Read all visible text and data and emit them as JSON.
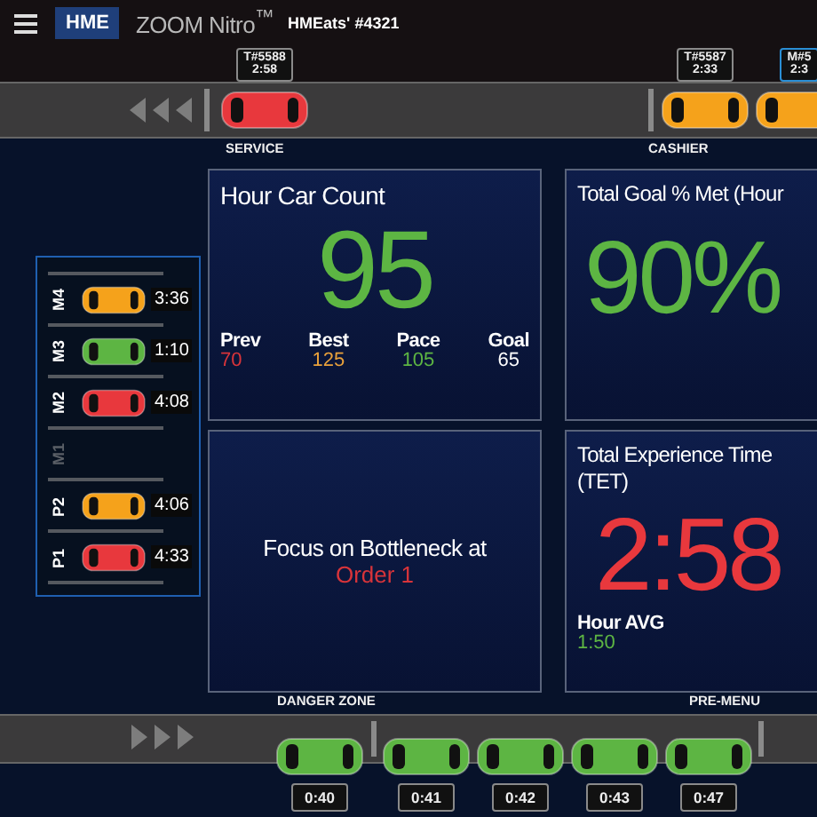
{
  "header": {
    "logo": "HME",
    "product": "ZOOM Nitro$^{™}$",
    "store": "HMEats' #4321"
  },
  "top_lane": {
    "zones": [
      {
        "label": "SERVICE",
        "cars": [
          {
            "color": "#e8383d",
            "ticket": "T#5588",
            "time": "2:58",
            "highlighted": false
          }
        ]
      },
      {
        "label": "CASHIER",
        "cars": [
          {
            "color": "#f5a21b",
            "ticket": "T#5587",
            "time": "2:33",
            "highlighted": false
          },
          {
            "color": "#f5a21b",
            "ticket": "M#5",
            "time": "2:3",
            "highlighted": true
          }
        ]
      }
    ]
  },
  "pull_forward": [
    {
      "label": "M4",
      "active": true,
      "color": "#f5a21b",
      "time": "3:36"
    },
    {
      "label": "M3",
      "active": true,
      "color": "#5db543",
      "time": "1:10"
    },
    {
      "label": "M2",
      "active": true,
      "color": "#e8383d",
      "time": "4:08"
    },
    {
      "label": "M1",
      "active": false
    },
    {
      "label": "P2",
      "active": true,
      "color": "#f5a21b",
      "time": "4:06"
    },
    {
      "label": "P1",
      "active": true,
      "color": "#e8383d",
      "time": "4:33"
    }
  ],
  "cards": [
    {
      "kind": "count",
      "title": "Hour Car Count",
      "value": "95",
      "color": "#5db543",
      "stats": [
        {
          "label": "Prev",
          "value": "70",
          "color": "#d8343a"
        },
        {
          "label": "Best",
          "value": "125",
          "color": "#e9a13b"
        },
        {
          "label": "Pace",
          "value": "105",
          "color": "#5db543"
        },
        {
          "label": "Goal",
          "value": "65",
          "color": "#ffffff"
        }
      ]
    },
    {
      "kind": "message",
      "text": "Focus on Bottleneck at",
      "highlight": "Order 1",
      "color": "#d8343a"
    },
    {
      "kind": "percent",
      "title": "Total Goal % Met (Hour",
      "value": "90%",
      "color": "#5db543"
    },
    {
      "kind": "time",
      "title": "Total Experience Time (TET)",
      "value": "2:58",
      "color": "#e8383d",
      "stats": [
        {
          "label": "Hour AVG",
          "value": "1:50",
          "color": "#5db543"
        }
      ]
    }
  ],
  "bottom_lane": {
    "zones": [
      {
        "label": "DANGER ZONE",
        "cars": [
          {
            "color": "#5db543",
            "time": "0:40",
            "highlighted": false
          }
        ]
      },
      {
        "label": "PRE-MENU",
        "cars": [
          {
            "color": "#5db543",
            "time": "0:41",
            "highlighted": false
          },
          {
            "color": "#5db543",
            "time": "0:42",
            "highlighted": false
          },
          {
            "color": "#5db543",
            "time": "0:43",
            "highlighted": false
          },
          {
            "color": "#5db543",
            "time": "0:47",
            "highlighted": false
          }
        ]
      }
    ]
  }
}
